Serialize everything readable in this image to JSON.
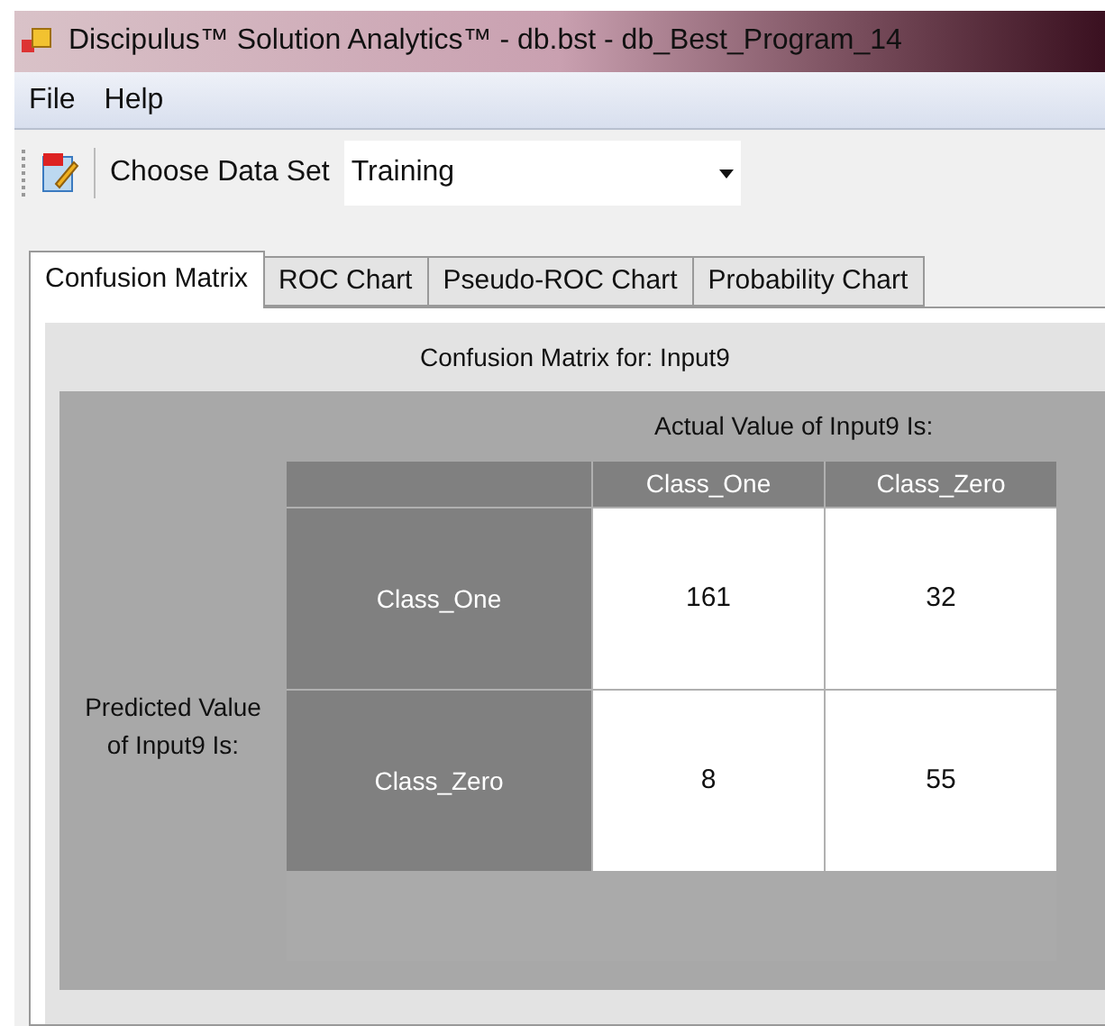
{
  "window": {
    "title": "Discipulus™ Solution Analytics™ - db.bst - db_Best_Program_14"
  },
  "menu": [
    "File",
    "Help"
  ],
  "toolbar": {
    "label": "Choose Data Set",
    "dataset": "Training"
  },
  "tabs": [
    {
      "label": "Confusion Matrix",
      "selected": true
    },
    {
      "label": "ROC Chart",
      "selected": false
    },
    {
      "label": "Pseudo-ROC Chart",
      "selected": false
    },
    {
      "label": "Probability Chart",
      "selected": false
    }
  ],
  "matrix": {
    "title": "Confusion Matrix for: Input9",
    "actual_label": "Actual Value of Input9 Is:",
    "predicted_label": "Predicted Value of Input9 Is:",
    "columns": [
      "Class_One",
      "Class_Zero"
    ],
    "rows": [
      {
        "label": "Class_One",
        "cells": [
          "161",
          "32"
        ]
      },
      {
        "label": "Class_Zero",
        "cells": [
          "8",
          "55"
        ]
      }
    ]
  }
}
